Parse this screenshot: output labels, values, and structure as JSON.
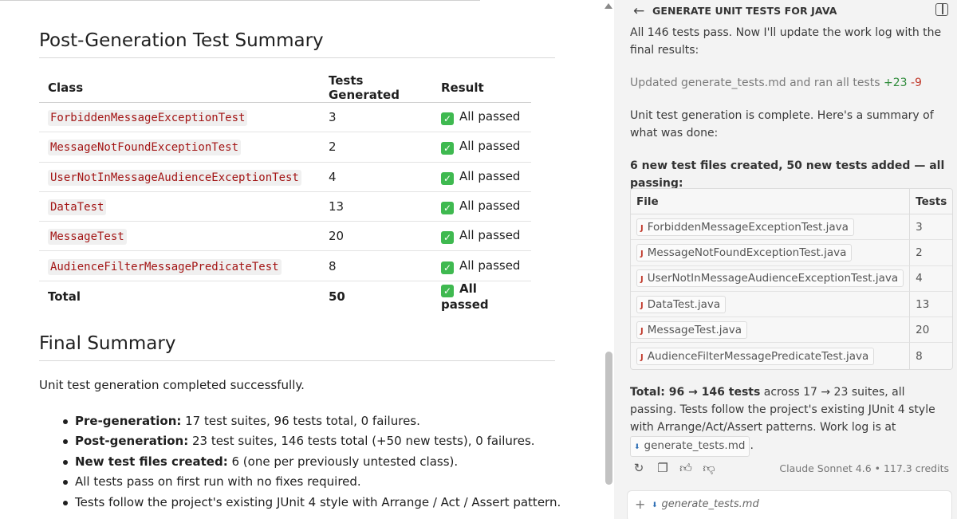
{
  "colors": {
    "code_text": "#a31515",
    "check_green": "#3fb950",
    "added_green": "#2e8b3a",
    "removed_red": "#c0392b",
    "panel_bg": "#f3f3f3"
  },
  "doc": {
    "post_heading": "Post-Generation Test Summary",
    "table": {
      "headers": [
        "Class",
        "Tests Generated",
        "Result"
      ],
      "rows": [
        {
          "class": "ForbiddenMessageExceptionTest",
          "tests": "3",
          "result": "All passed"
        },
        {
          "class": "MessageNotFoundExceptionTest",
          "tests": "2",
          "result": "All passed"
        },
        {
          "class": "UserNotInMessageAudienceExceptionTest",
          "tests": "4",
          "result": "All passed"
        },
        {
          "class": "DataTest",
          "tests": "13",
          "result": "All passed"
        },
        {
          "class": "MessageTest",
          "tests": "20",
          "result": "All passed"
        },
        {
          "class": "AudienceFilterMessagePredicateTest",
          "tests": "8",
          "result": "All passed"
        }
      ],
      "total": {
        "label": "Total",
        "tests": "50",
        "result": "All passed"
      }
    },
    "final_heading": "Final Summary",
    "final_intro": "Unit test generation completed successfully.",
    "bullets": [
      {
        "bold": "Pre-generation:",
        "text": " 17 test suites, 96 tests total, 0 failures."
      },
      {
        "bold": "Post-generation:",
        "text": " 23 test suites, 146 tests total (+50 new tests), 0 failures."
      },
      {
        "bold": "New test files created:",
        "text": " 6 (one per previously untested class)."
      },
      {
        "bold": "",
        "text": "All tests pass on first run with no fixes required."
      },
      {
        "bold": "",
        "text": "Tests follow the project's existing JUnit 4 style with Arrange / Act / Assert pattern."
      }
    ]
  },
  "chat": {
    "title": "GENERATE UNIT TESTS FOR JAVA",
    "back_icon": "arrow-left-icon",
    "panel_icon": "panel-toggle-icon",
    "msg1": "All 146 tests pass. Now I'll update the work log with the final results:",
    "msg2": {
      "prefix": "Updated ",
      "file": "generate_tests.md",
      "middle": " and ran all tests ",
      "added": "+23",
      "removed": "-9"
    },
    "msg3": "Unit test generation is complete. Here's a summary of what was done:",
    "msg4": "6 new test files created, 50 new tests added — all passing:",
    "files_table": {
      "headers": [
        "File",
        "Tests"
      ],
      "rows": [
        {
          "file": "ForbiddenMessageExceptionTest.java",
          "tests": "3"
        },
        {
          "file": "MessageNotFoundExceptionTest.java",
          "tests": "2"
        },
        {
          "file": "UserNotInMessageAudienceExceptionTest.java",
          "tests": "4"
        },
        {
          "file": "DataTest.java",
          "tests": "13"
        },
        {
          "file": "MessageTest.java",
          "tests": "20"
        },
        {
          "file": "AudienceFilterMessagePredicateTest.java",
          "tests": "8"
        }
      ]
    },
    "msg5": {
      "bold": "Total: 96 → 146 tests",
      "text": " across 17 → 23 suites, all passing. Tests follow the project's existing JUnit 4 style with Arrange/Act/Assert patterns. Work log is at ",
      "file": "generate_tests.md",
      "end": "."
    },
    "actions": [
      "retry-icon",
      "copy-icon",
      "thumbs-up-icon",
      "thumbs-down-icon"
    ],
    "model_info": "Claude Sonnet 4.6 • 117.3 credits",
    "input": {
      "add_icon": "plus-icon",
      "context_file": "generate_tests.md"
    }
  }
}
